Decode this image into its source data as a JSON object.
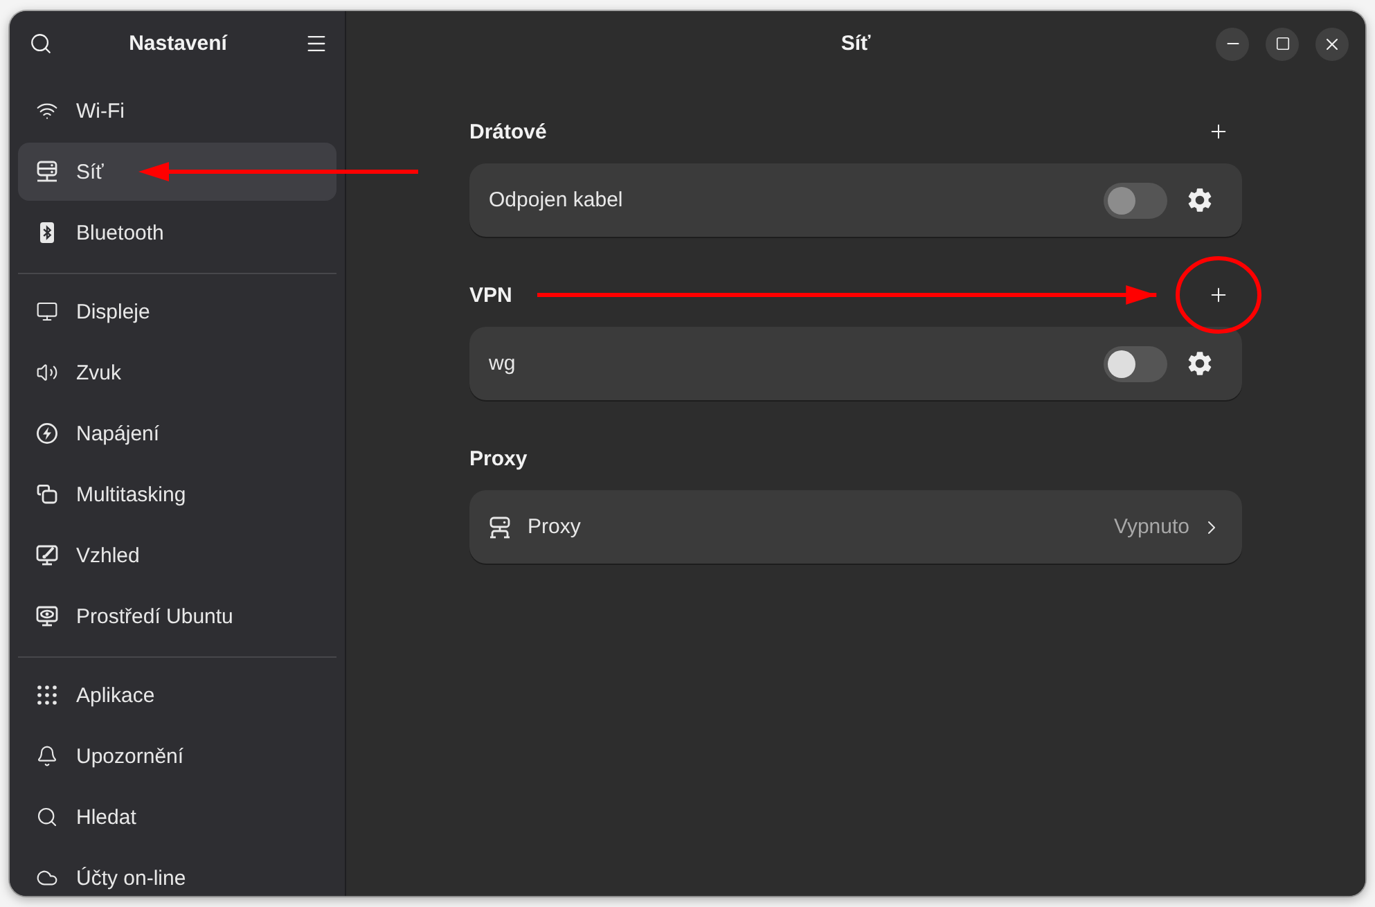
{
  "sidebar": {
    "title": "Nastavení",
    "groups": [
      {
        "items": [
          {
            "label": "Wi-Fi",
            "selected": false,
            "arrow": false
          },
          {
            "label": "Síť",
            "selected": true,
            "arrow": true
          },
          {
            "label": "Bluetooth",
            "selected": false,
            "arrow": false
          }
        ]
      },
      {
        "items": [
          {
            "label": "Displeje",
            "selected": false,
            "arrow": false
          },
          {
            "label": "Zvuk",
            "selected": false,
            "arrow": false
          },
          {
            "label": "Napájení",
            "selected": false,
            "arrow": false
          },
          {
            "label": "Multitasking",
            "selected": false,
            "arrow": false
          },
          {
            "label": "Vzhled",
            "selected": false,
            "arrow": false
          },
          {
            "label": "Prostředí Ubuntu",
            "selected": false,
            "arrow": false
          }
        ]
      },
      {
        "items": [
          {
            "label": "Aplikace",
            "selected": false,
            "arrow": false
          },
          {
            "label": "Upozornění",
            "selected": false,
            "arrow": false
          },
          {
            "label": "Hledat",
            "selected": false,
            "arrow": false
          },
          {
            "label": "Účty on-line",
            "selected": false,
            "arrow": false
          }
        ]
      }
    ]
  },
  "page": {
    "title": "Síť",
    "sections": [
      {
        "title": "Drátové",
        "arrow": false,
        "add_button": {
          "circled": false
        },
        "rows": [
          {
            "kind": "toggle",
            "label": "Odpojen kabel",
            "on": false,
            "disabled": true
          }
        ]
      },
      {
        "title": "VPN",
        "arrow": true,
        "add_button": {
          "circled": true
        },
        "rows": [
          {
            "kind": "toggle",
            "label": "wg",
            "on": false,
            "disabled": false
          }
        ]
      },
      {
        "title": "Proxy",
        "arrow": false,
        "rows": [
          {
            "kind": "link",
            "label": "Proxy",
            "value": "Vypnuto"
          }
        ]
      }
    ]
  }
}
